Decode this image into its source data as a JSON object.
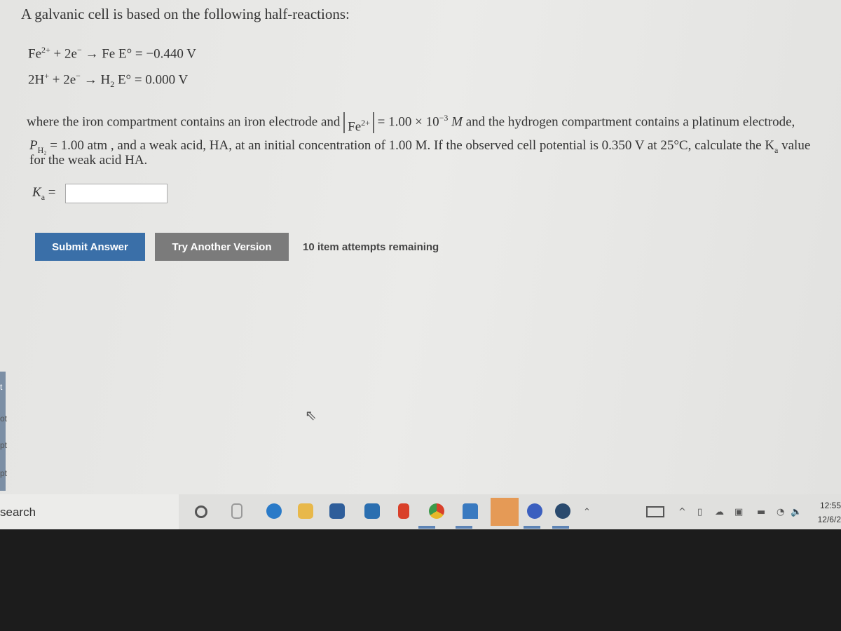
{
  "question": {
    "intro": "A galvanic cell is based on the following half-reactions:",
    "reaction1": {
      "left": "Fe",
      "charge": "2+",
      "rest": " + 2e",
      "minus": "−",
      "arrow": " → Fe  E° = −0.440 V"
    },
    "reaction2": {
      "left": "2H",
      "charge": "+",
      "rest": " + 2e",
      "minus": "−",
      "arrow": " → H",
      "sub": "2",
      "e": "  E° = 0.000 V"
    },
    "line1_a": "where the iron compartment contains an iron electrode and",
    "fe": "Fe",
    "fe_charge": "2+",
    "line1_b": " = 1.00 × 10",
    "exp": "−3",
    "line1_c": " M",
    "line1_d": " and the hydrogen compartment contains a platinum electrode,",
    "p": "P",
    "p_sub": "H₂",
    "line2_a": " = 1.00 atm , and a weak acid, HA, at an initial concentration of 1.00 M. If the observed cell potential is 0.350 V at 25°C, calculate the K",
    "ka_sub": "a",
    "line2_b": " value",
    "line3": "for the weak acid HA.",
    "ka_label": "K",
    "ka_label_sub": "a",
    "ka_eq": " =",
    "ka_value": ""
  },
  "buttons": {
    "submit": "Submit Answer",
    "try_another": "Try Another Version"
  },
  "attempts": "10 item attempts remaining",
  "sidebar_fragments": [
    "t",
    "ot",
    "pt",
    "pt"
  ],
  "taskbar": {
    "search": "search",
    "icons": [
      "cortana-icon",
      "task-view-icon",
      "edge-icon",
      "file-explorer-icon",
      "store-icon",
      "mail-icon",
      "office-icon",
      "chrome-icon",
      "onedrive-icon",
      "teams-icon",
      "discord-icon",
      "steam-icon"
    ],
    "time": "12:55",
    "date": "12/6/2"
  },
  "colors": {
    "submit": "#3a6fa8",
    "try_another": "#7b7b7b"
  }
}
